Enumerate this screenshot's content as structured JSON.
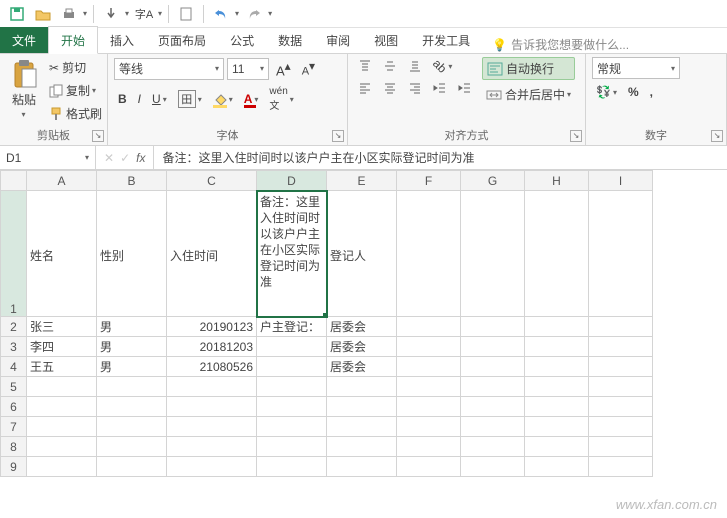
{
  "qat": {},
  "tabs": {
    "file": "文件",
    "home": "开始",
    "insert": "插入",
    "layout": "页面布局",
    "formula": "公式",
    "data": "数据",
    "review": "审阅",
    "view": "视图",
    "dev": "开发工具",
    "tellme": "告诉我您想要做什么..."
  },
  "ribbon": {
    "clipboard": {
      "paste": "粘贴",
      "cut": "剪切",
      "copy": "复制",
      "painter": "格式刷",
      "label": "剪贴板"
    },
    "font": {
      "name": "等线",
      "size": "11",
      "label": "字体"
    },
    "align": {
      "wrap": "自动换行",
      "merge": "合并后居中",
      "label": "对齐方式"
    },
    "number": {
      "format": "常规",
      "label": "数字"
    }
  },
  "namebox": "D1",
  "formula": "备注：这里入住时间时以该户户主在小区实际登记时间为准",
  "cols": [
    "A",
    "B",
    "C",
    "D",
    "E",
    "F",
    "G",
    "H",
    "I"
  ],
  "rows": [
    "1",
    "2",
    "3",
    "4",
    "5",
    "6",
    "7",
    "8",
    "9"
  ],
  "data": {
    "r1": {
      "A": "姓名",
      "B": "性别",
      "C": "入住时间",
      "D": "备注：这里入住时间时以该户户主在小区实际登记时间为准",
      "E": "登记人"
    },
    "r2": {
      "A": "张三",
      "B": "男",
      "C": "20190123",
      "D": "户主登记：",
      "E": "居委会"
    },
    "r3": {
      "A": "李四",
      "B": "男",
      "C": "20181203",
      "D": "",
      "E": "居委会"
    },
    "r4": {
      "A": "王五",
      "B": "男",
      "C": "21080526",
      "D": "",
      "E": "居委会"
    }
  },
  "watermark": "www.xfan.com.cn"
}
